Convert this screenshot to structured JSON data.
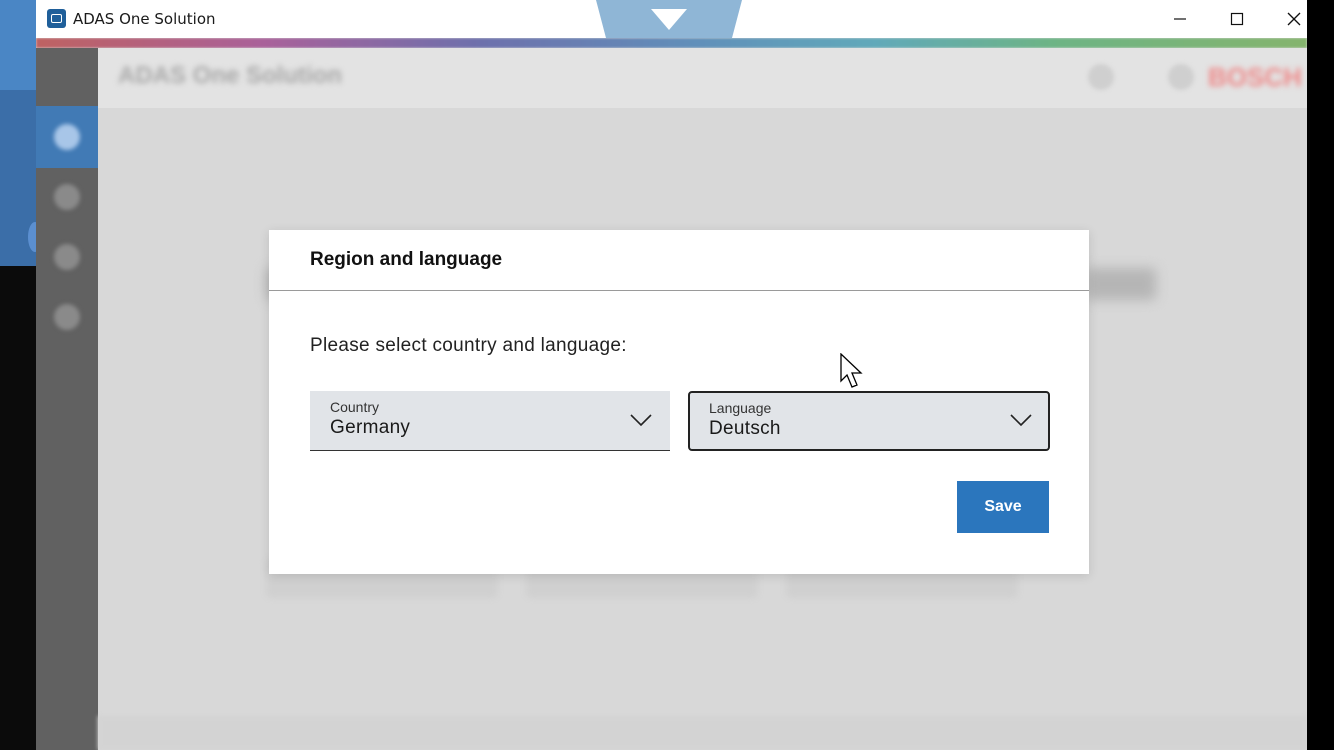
{
  "window": {
    "title": "ADAS One Solution",
    "buttons": [
      "minimize",
      "maximize",
      "close"
    ]
  },
  "background_app": {
    "header_title": "ADAS One Solution",
    "brand": "BOSCH",
    "accent_color": "#2b76bd"
  },
  "dialog": {
    "title": "Region and language",
    "prompt": "Please select country and language:",
    "country": {
      "label": "Country",
      "value": "Germany"
    },
    "language": {
      "label": "Language",
      "value": "Deutsch"
    },
    "save_label": "Save"
  },
  "icons": [
    "app-icon",
    "minimize-icon",
    "maximize-icon",
    "close-icon",
    "chevron-down-icon",
    "mouse-cursor"
  ]
}
